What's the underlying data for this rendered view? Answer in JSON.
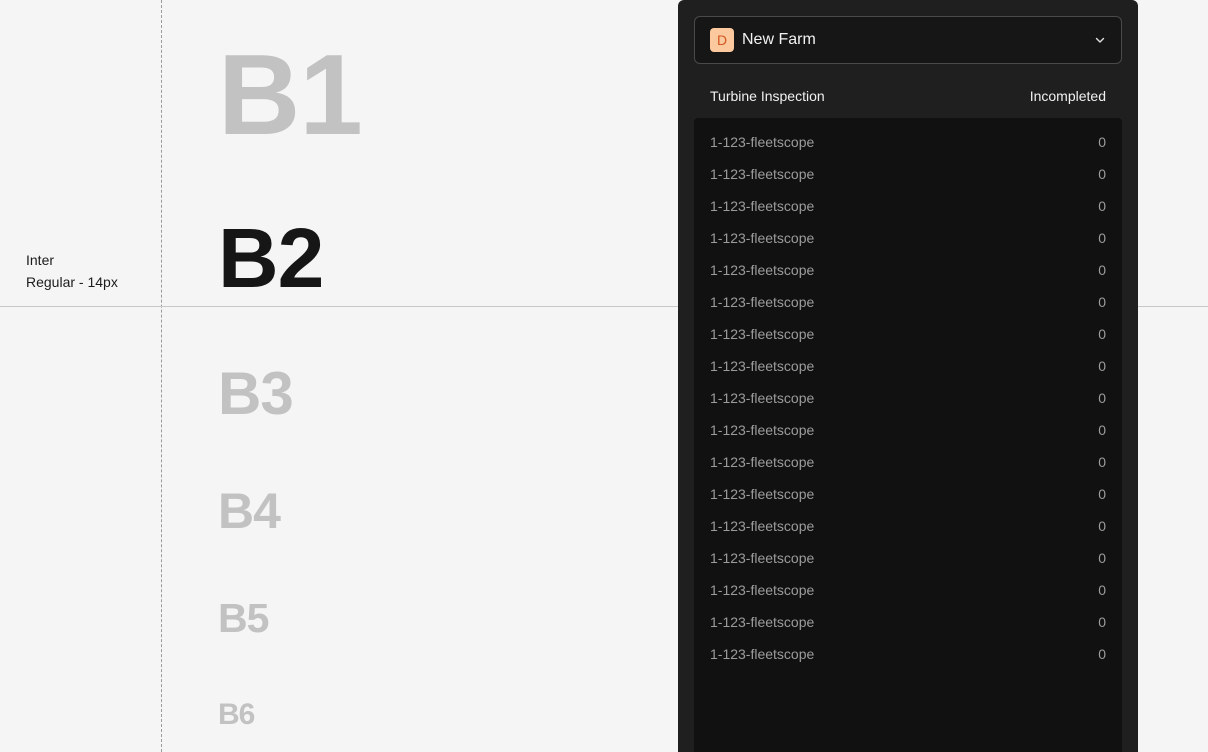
{
  "annotation": {
    "font_family": "Inter",
    "font_spec": "Regular - 14px"
  },
  "scale": [
    "B1",
    "B2",
    "B3",
    "B4",
    "B5",
    "B6"
  ],
  "panel": {
    "farm_badge": "D",
    "farm_name": "New Farm",
    "farm_badge_colors": {
      "background": "#fcc99e",
      "text": "#d2561f"
    },
    "columns": {
      "name": "Turbine Inspection",
      "status": "Incompleted"
    },
    "rows": [
      {
        "name": "1-123-fleetscope",
        "count": "0"
      },
      {
        "name": "1-123-fleetscope",
        "count": "0"
      },
      {
        "name": "1-123-fleetscope",
        "count": "0"
      },
      {
        "name": "1-123-fleetscope",
        "count": "0"
      },
      {
        "name": "1-123-fleetscope",
        "count": "0"
      },
      {
        "name": "1-123-fleetscope",
        "count": "0"
      },
      {
        "name": "1-123-fleetscope",
        "count": "0"
      },
      {
        "name": "1-123-fleetscope",
        "count": "0"
      },
      {
        "name": "1-123-fleetscope",
        "count": "0"
      },
      {
        "name": "1-123-fleetscope",
        "count": "0"
      },
      {
        "name": "1-123-fleetscope",
        "count": "0"
      },
      {
        "name": "1-123-fleetscope",
        "count": "0"
      },
      {
        "name": "1-123-fleetscope",
        "count": "0"
      },
      {
        "name": "1-123-fleetscope",
        "count": "0"
      },
      {
        "name": "1-123-fleetscope",
        "count": "0"
      },
      {
        "name": "1-123-fleetscope",
        "count": "0"
      },
      {
        "name": "1-123-fleetscope",
        "count": "0"
      }
    ]
  }
}
